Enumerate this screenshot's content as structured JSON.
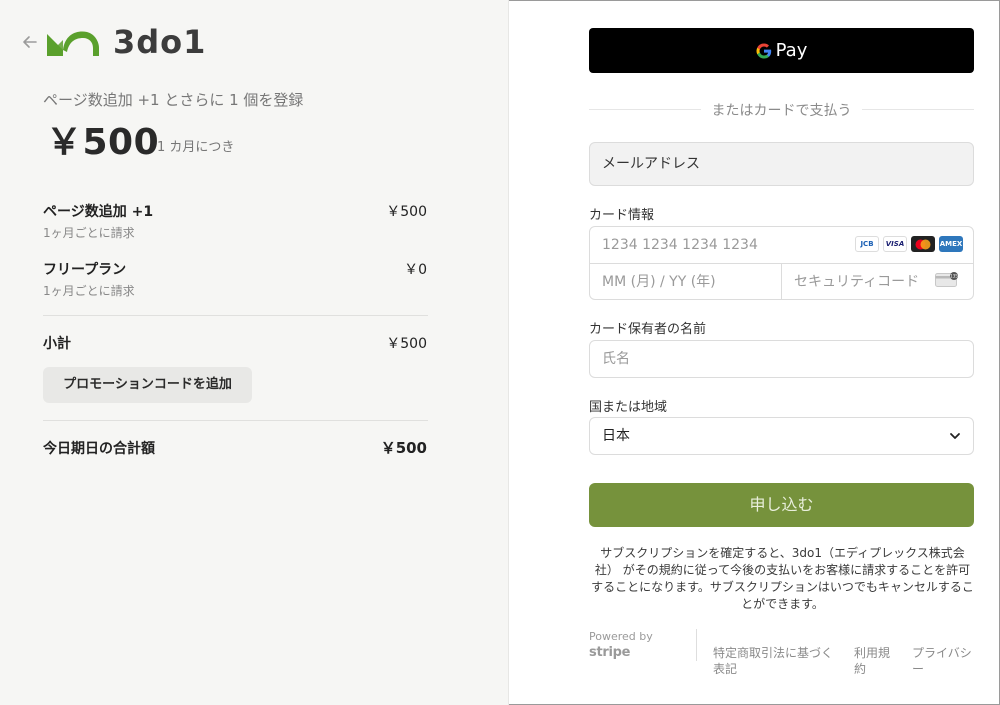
{
  "summary": {
    "plan_description": "ページ数追加 +1 とさらに 1 個を登録",
    "price": "￥500",
    "price_unit": "1 カ月につき",
    "brand_name": "3do1",
    "items": [
      {
        "name": "ページ数追加 +1",
        "billing": "1ヶ月ごとに請求",
        "amount": "￥500"
      },
      {
        "name": "フリープラン",
        "billing": "1ヶ月ごとに請求",
        "amount": "￥0"
      }
    ],
    "subtotal_label": "小計",
    "subtotal_amount": "￥500",
    "promo_label": "プロモーションコードを追加",
    "total_label": "今日期日の合計額",
    "total_amount": "￥500"
  },
  "payment": {
    "gpay_label": "Pay",
    "or_text": "またはカードで支払う",
    "email_label": "メールアドレス",
    "card_label": "カード情報",
    "card_number_placeholder": "1234 1234 1234 1234",
    "card_expiry_placeholder": "MM (月) / YY (年)",
    "card_cvc_placeholder": "セキュリティコード",
    "card_brands": [
      "JCB",
      "VISA",
      "Mastercard",
      "AMEX"
    ],
    "cardholder_label": "カード保有者の名前",
    "cardholder_placeholder": "氏名",
    "country_label": "国または地域",
    "country_value": "日本",
    "submit_label": "申し込む",
    "terms_text": "サブスクリプションを確定すると、3do1（エディプレックス株式会社） がその規約に従って今後の支払いをお客様に請求することを許可することになります。サブスクリプションはいつでもキャンセルすることができます。"
  },
  "footer": {
    "powered_by": "Powered by",
    "stripe": "stripe",
    "links": [
      "特定商取引法に基づく表記",
      "利用規約",
      "プライバシー"
    ]
  },
  "colors": {
    "accent_green": "#76923c",
    "logo_green": "#5aa02c",
    "left_bg": "#f6f6f4"
  }
}
